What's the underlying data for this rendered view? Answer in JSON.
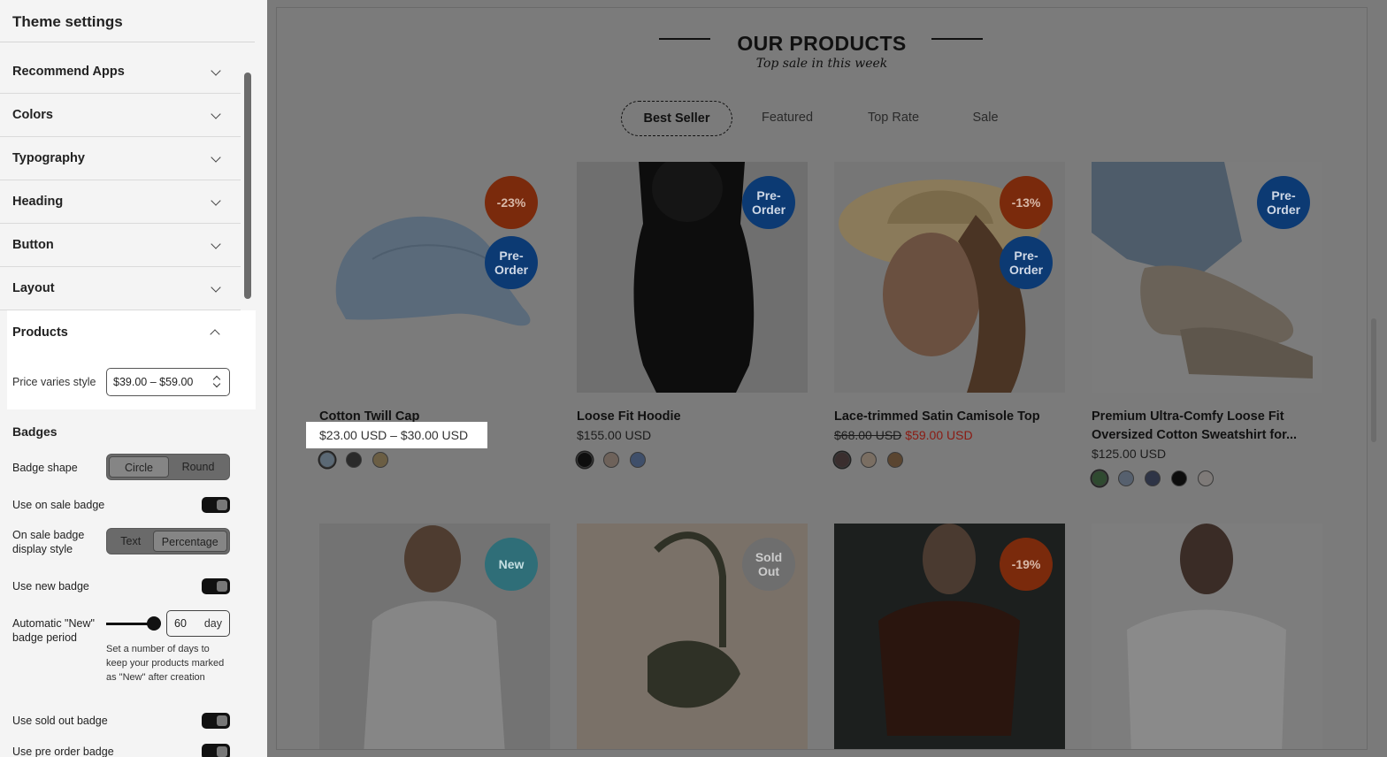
{
  "sidebar": {
    "title": "Theme settings",
    "sections": [
      {
        "label": "Recommend Apps"
      },
      {
        "label": "Colors"
      },
      {
        "label": "Typography"
      },
      {
        "label": "Heading"
      },
      {
        "label": "Button"
      },
      {
        "label": "Layout"
      }
    ],
    "products": {
      "label": "Products",
      "price_varies_label": "Price varies style",
      "price_varies_value": "$39.00 – $59.00"
    },
    "badges": {
      "title": "Badges",
      "badge_shape_label": "Badge shape",
      "badge_shape_options": [
        "Circle",
        "Round"
      ],
      "badge_shape_selected": "Circle",
      "use_on_sale_label": "Use on sale badge",
      "use_on_sale": true,
      "on_sale_style_label": "On sale badge display style",
      "on_sale_style_options": [
        "Text",
        "Percentage"
      ],
      "on_sale_style_selected": "Percentage",
      "use_new_label": "Use new badge",
      "use_new": true,
      "auto_new_label": "Automatic \"New\" badge period",
      "auto_new_value": "60",
      "auto_new_unit": "day",
      "auto_new_help": "Set a number of days to keep your products marked as \"New\" after creation",
      "use_sold_out_label": "Use sold out badge",
      "use_sold_out": true,
      "use_pre_order_label": "Use pre order badge",
      "use_pre_order": true
    }
  },
  "main": {
    "heading": "OUR PRODUCTS",
    "subheading": "Top sale in this week",
    "tabs": [
      "Best Seller",
      "Featured",
      "Top Rate",
      "Sale"
    ],
    "active_tab": "Best Seller",
    "products": [
      {
        "title": "Cotton Twill Cap",
        "price": "$23.00 USD – $30.00 USD",
        "badges": [
          "-23%",
          "Pre-Order"
        ]
      },
      {
        "title": "Loose Fit Hoodie",
        "price": "$155.00 USD",
        "badges": [
          "Pre-Order"
        ]
      },
      {
        "title": "Lace-trimmed Satin Camisole Top",
        "price_old": "$68.00 USD",
        "price_sale": "$59.00 USD",
        "badges": [
          "-13%",
          "Pre-Order"
        ]
      },
      {
        "title": "Premium Ultra-Comfy Loose Fit Oversized Cotton Sweatshirt for...",
        "price": "$125.00 USD",
        "badges": [
          "Pre-Order"
        ]
      },
      {
        "badges": [
          "New"
        ]
      },
      {
        "badges": [
          "Sold Out"
        ]
      },
      {
        "badges": [
          "-19%"
        ]
      },
      {
        "badges": []
      }
    ],
    "badge_labels": {
      "sale1": "-23%",
      "pre1a": "Pre-",
      "pre1b": "Order",
      "sale3": "-13%",
      "new": "New",
      "sold_a": "Sold",
      "sold_b": "Out",
      "sale7": "-19%"
    }
  },
  "colors": {
    "sale_badge": "#c2410c",
    "pre_order_badge": "#1d4ed8",
    "new_badge": "#4fb5c2",
    "sold_out_badge": "#a3a3a3",
    "sale_price": "#dc2626"
  }
}
